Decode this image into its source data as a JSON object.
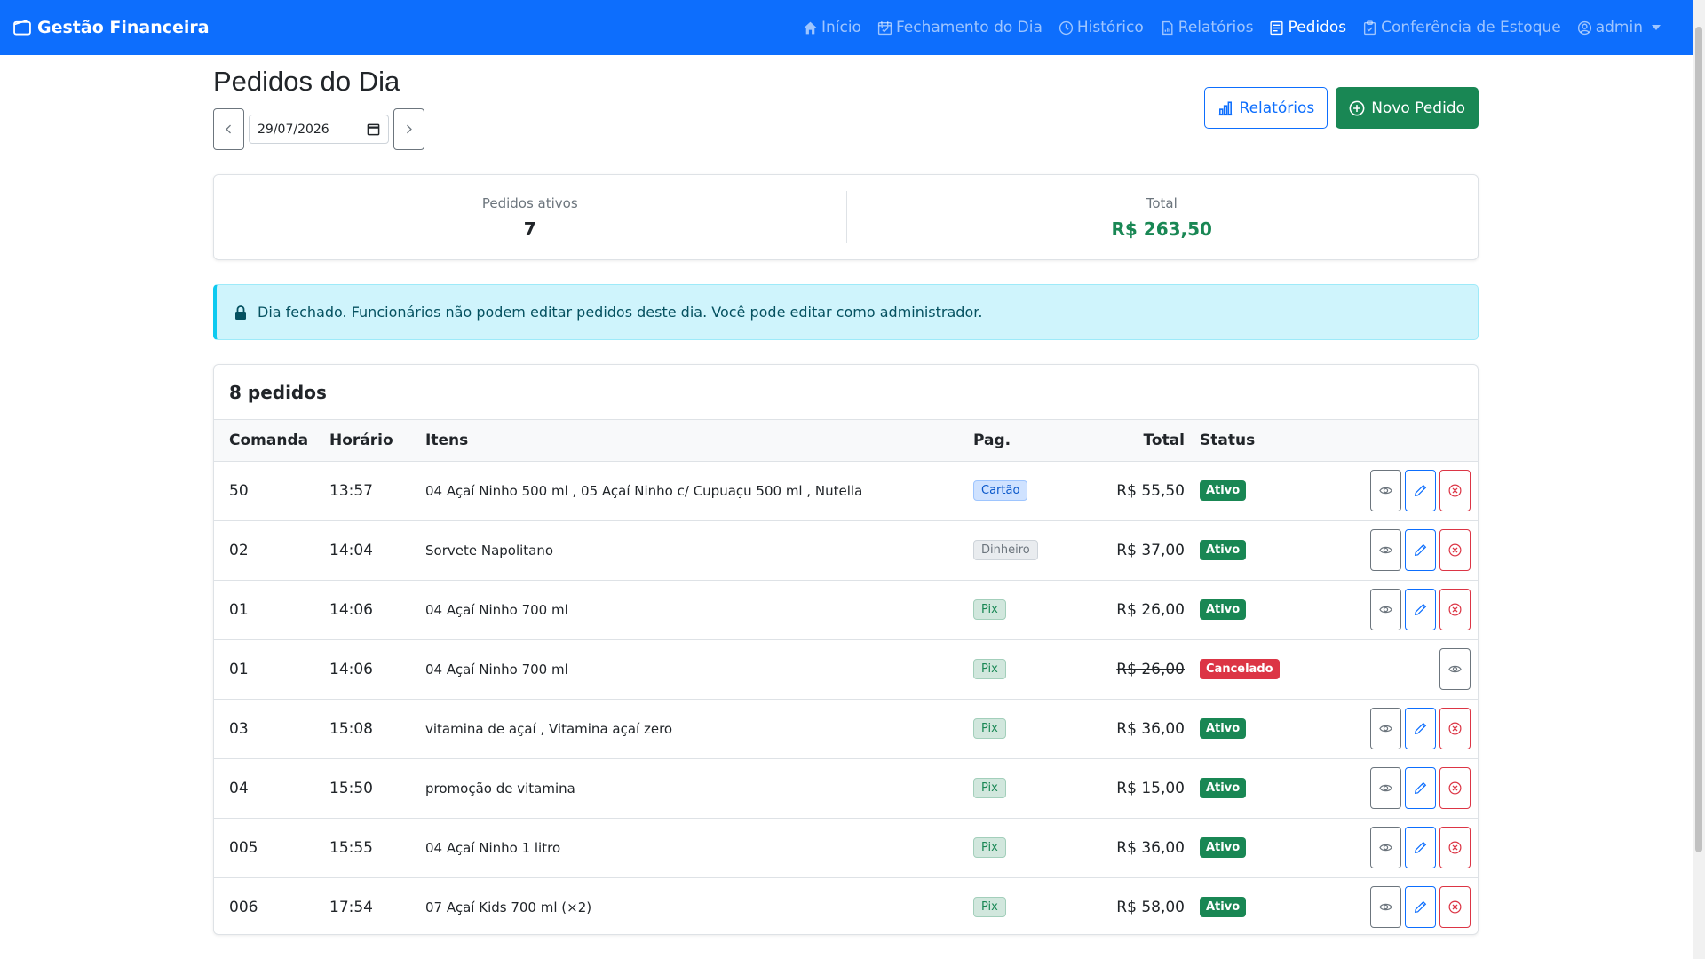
{
  "navbar": {
    "brand": "Gestão Financeira",
    "links": [
      {
        "label": "Início",
        "icon": "house-icon"
      },
      {
        "label": "Fechamento do Dia",
        "icon": "calendar-check-icon"
      },
      {
        "label": "Histórico",
        "icon": "clock-icon"
      },
      {
        "label": "Relatórios",
        "icon": "file-chart-icon"
      },
      {
        "label": "Pedidos",
        "icon": "receipt-icon",
        "active": true
      },
      {
        "label": "Conferência de Estoque",
        "icon": "clipboard-check-icon"
      }
    ],
    "user": "admin"
  },
  "page": {
    "title": "Pedidos do Dia",
    "date_value": "29/07/2026"
  },
  "actions": {
    "reports_label": "Relatórios",
    "new_order_label": "Novo Pedido"
  },
  "summary": {
    "active_label": "Pedidos ativos",
    "active_value": "7",
    "total_label": "Total",
    "total_value": "R$ 263,50"
  },
  "alert": {
    "text": "Dia fechado. Funcionários não podem editar pedidos deste dia. Você pode editar como administrador."
  },
  "orders": {
    "header": "8 pedidos",
    "columns": {
      "comanda": "Comanda",
      "horario": "Horário",
      "itens": "Itens",
      "pag": "Pag.",
      "total": "Total",
      "status": "Status"
    },
    "rows": [
      {
        "comanda": "50",
        "horario": "13:57",
        "itens": "04 Açaí Ninho 500 ml , 05 Açaí Ninho c/ Cupuaçu 500 ml , Nutella",
        "pag": "Cartão",
        "pag_type": "cartao",
        "total": "R$ 55,50",
        "status": "Ativo"
      },
      {
        "comanda": "02",
        "horario": "14:04",
        "itens": "Sorvete Napolitano",
        "pag": "Dinheiro",
        "pag_type": "dinheiro",
        "total": "R$ 37,00",
        "status": "Ativo"
      },
      {
        "comanda": "01",
        "horario": "14:06",
        "itens": "04 Açaí Ninho 700 ml",
        "pag": "Pix",
        "pag_type": "pix",
        "total": "R$ 26,00",
        "status": "Ativo"
      },
      {
        "comanda": "01",
        "horario": "14:06",
        "itens": "04 Açaí Ninho 700 ml",
        "pag": "Pix",
        "pag_type": "pix",
        "total": "R$ 26,00",
        "status": "Cancelado"
      },
      {
        "comanda": "03",
        "horario": "15:08",
        "itens": "vitamina de açaí , Vitamina açaí zero",
        "pag": "Pix",
        "pag_type": "pix",
        "total": "R$ 36,00",
        "status": "Ativo"
      },
      {
        "comanda": "04",
        "horario": "15:50",
        "itens": "promoção de vitamina",
        "pag": "Pix",
        "pag_type": "pix",
        "total": "R$ 15,00",
        "status": "Ativo"
      },
      {
        "comanda": "005",
        "horario": "15:55",
        "itens": "04 Açaí Ninho 1 litro",
        "pag": "Pix",
        "pag_type": "pix",
        "total": "R$ 36,00",
        "status": "Ativo"
      },
      {
        "comanda": "006",
        "horario": "17:54",
        "itens": "07 Açaí Kids 700 ml (×2)",
        "pag": "Pix",
        "pag_type": "pix",
        "total": "R$ 58,00",
        "status": "Ativo"
      }
    ]
  },
  "colors": {
    "primary": "#0d6efd",
    "success": "#198754",
    "danger": "#dc3545",
    "info_bg": "#cff4fc"
  }
}
